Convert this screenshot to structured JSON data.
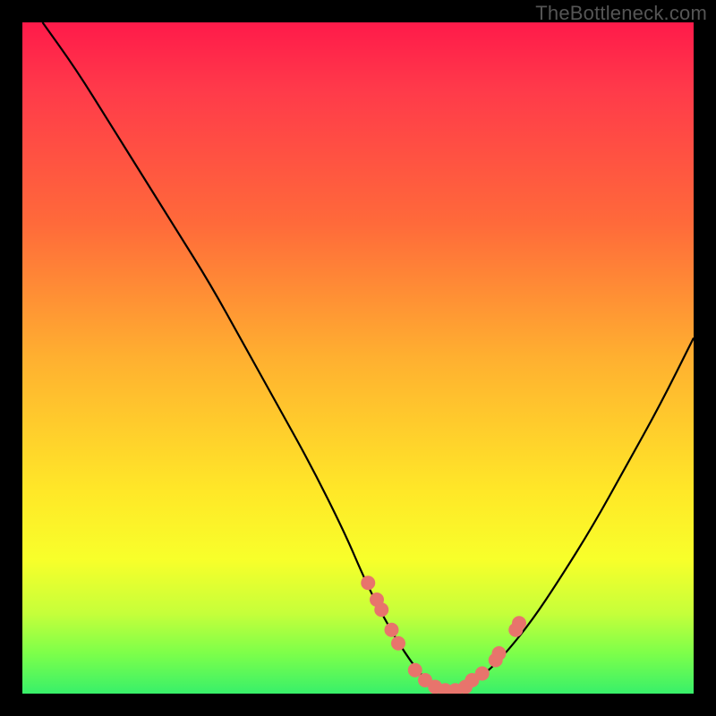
{
  "watermark": "TheBottleneck.com",
  "colors": {
    "background": "#000000",
    "curve": "#000000",
    "dot": "#e8746c",
    "gradient_top": "#ff1a4a",
    "gradient_bottom": "#38f06a"
  },
  "chart_data": {
    "type": "line",
    "title": "",
    "xlabel": "",
    "ylabel": "",
    "xlim": [
      0,
      100
    ],
    "ylim": [
      0,
      100
    ],
    "annotations": [
      "TheBottleneck.com"
    ],
    "series": [
      {
        "name": "bottleneck-curve-left",
        "x_pct": [
          3,
          8,
          13,
          18,
          23,
          28,
          33,
          38,
          43,
          48,
          51,
          54,
          57,
          60,
          63
        ],
        "y_pct": [
          100,
          93,
          85,
          77,
          69,
          61,
          52,
          43,
          34,
          24,
          17,
          11,
          6,
          2,
          0
        ]
      },
      {
        "name": "bottleneck-curve-right",
        "x_pct": [
          63,
          66,
          69,
          72,
          76,
          80,
          85,
          90,
          95,
          100
        ],
        "y_pct": [
          0,
          1,
          3,
          6,
          11,
          17,
          25,
          34,
          43,
          53
        ]
      }
    ],
    "points": {
      "name": "highlighted-points",
      "x_pct": [
        51.5,
        52.8,
        53.5,
        55.0,
        56.0,
        58.5,
        60.0,
        61.5,
        63.0,
        64.5,
        66.0,
        67.0,
        68.5,
        70.5,
        71.0,
        73.5,
        74.0
      ],
      "y_pct": [
        16.5,
        14.0,
        12.5,
        9.5,
        7.5,
        3.5,
        2.0,
        1.0,
        0.5,
        0.5,
        1.0,
        2.0,
        3.0,
        5.0,
        6.0,
        9.5,
        10.5
      ]
    }
  }
}
